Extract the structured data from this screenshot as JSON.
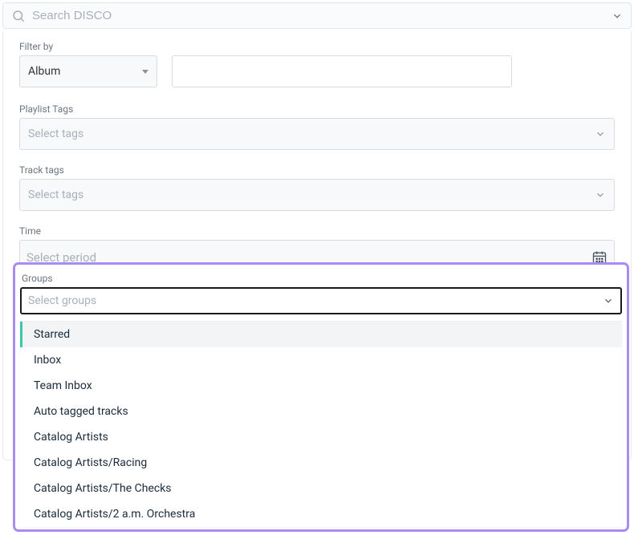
{
  "search": {
    "placeholder": "Search DISCO"
  },
  "filter_by": {
    "label": "Filter by",
    "value": "Album"
  },
  "playlist_tags": {
    "label": "Playlist Tags",
    "placeholder": "Select tags"
  },
  "track_tags": {
    "label": "Track tags",
    "placeholder": "Select tags"
  },
  "time": {
    "label": "Time",
    "placeholder": "Select period"
  },
  "groups": {
    "label": "Groups",
    "placeholder": "Select groups",
    "options": [
      "Starred",
      "Inbox",
      "Team Inbox",
      "Auto tagged tracks",
      "Catalog Artists",
      "Catalog Artists/Racing",
      "Catalog Artists/The Checks",
      "Catalog Artists/2 a.m. Orchestra"
    ]
  }
}
